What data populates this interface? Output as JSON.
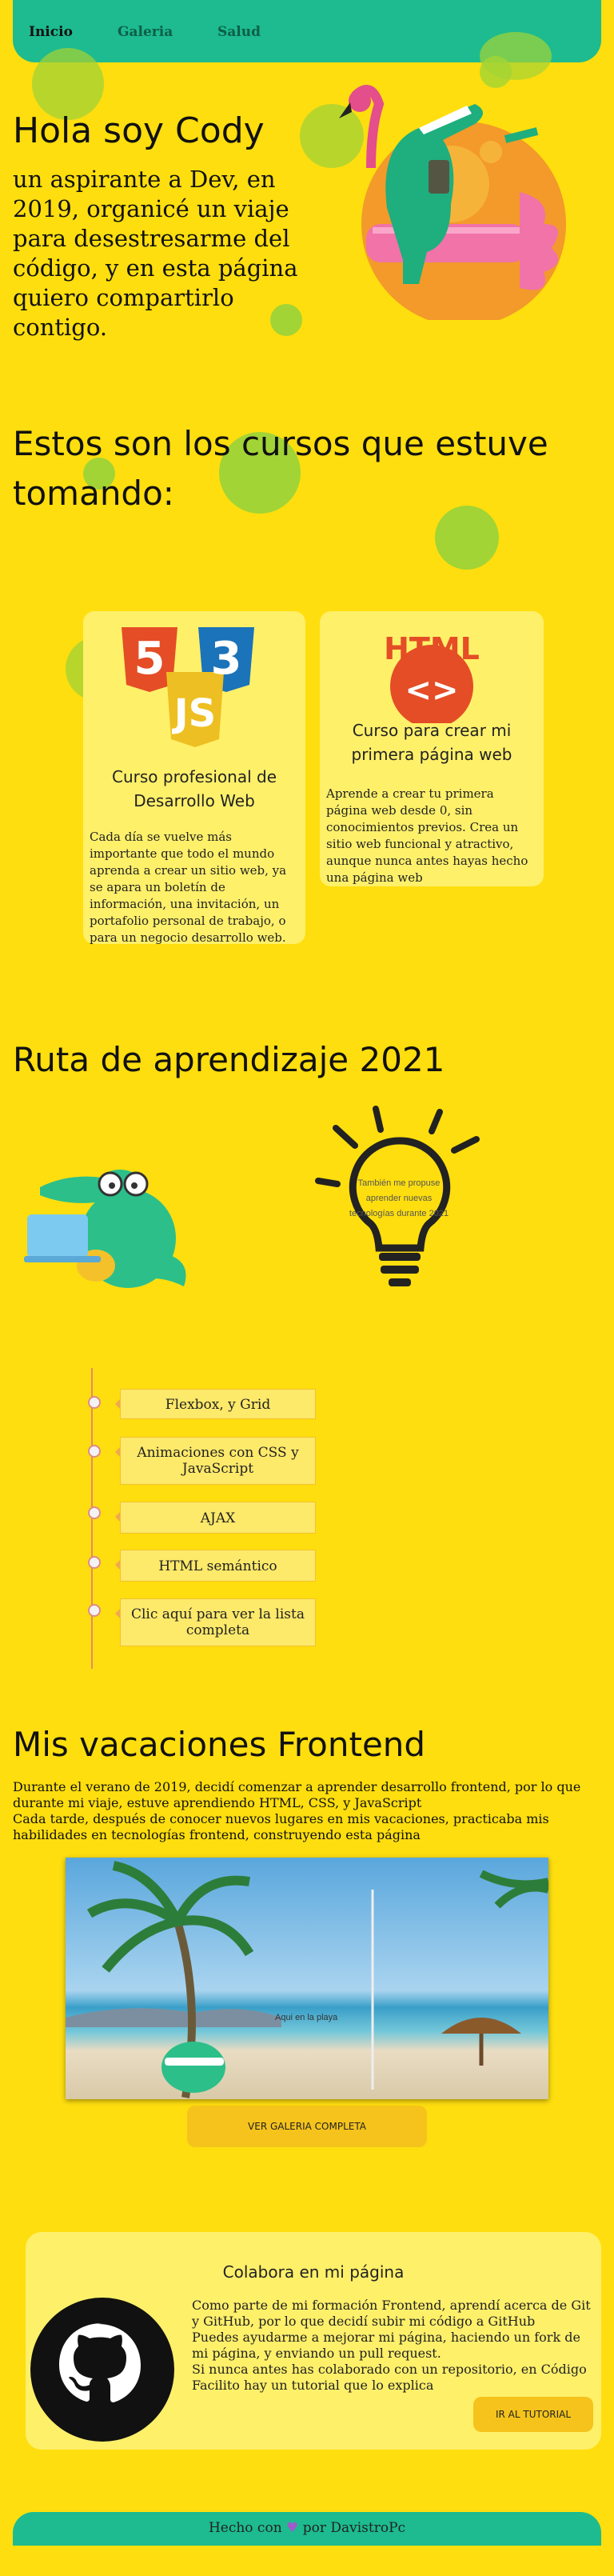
{
  "nav": {
    "items": [
      "Inicio",
      "Galeria",
      "Salud"
    ]
  },
  "hero": {
    "title": "Hola soy Cody",
    "intro": "un aspirante a Dev, en 2019, organicé un viaje para desestresarme del código, y en esta página quiero compartirlo contigo."
  },
  "courses": {
    "heading": "Estos son los cursos que estuve tomando:",
    "items": [
      {
        "title": "Curso profesional de Desarrollo Web",
        "text": "Cada día se vuelve más importante que todo el mundo aprenda a crear un sitio web, ya se apara un boletín de información, una invitación, un portafolio personal de trabajo, o para un negocio desarrollo web."
      },
      {
        "title": "Curso para crear mi primera página web",
        "text": "Aprende a crear tu primera página web desde 0, sin conocimientos previos. Crea un sitio web funcional y atractivo, aunque nunca antes hayas hecho una página web"
      }
    ],
    "badges": {
      "html": "HTML",
      "html_glyph": "<>",
      "css": "3",
      "html5": "5",
      "js": "JS"
    }
  },
  "ruta": {
    "heading": "Ruta de aprendizaje 2021",
    "bulb_text": "También me propuse aprender nuevas tecnologías durante 2021",
    "timeline": [
      "Flexbox, y Grid",
      "Animaciones con CSS y JavaScript",
      "AJAX",
      "HTML semántico",
      "Clic aquí para ver la lista completa"
    ]
  },
  "vacaciones": {
    "heading": "Mis vacaciones Frontend",
    "paragraph1": "Durante el verano de 2019, decidí comenzar a aprender desarrollo frontend, por lo que durante mi viaje, estuve aprendiendo HTML, CSS, y JavaScript",
    "paragraph2": "Cada tarde, después de conocer nuevos lugares en mis vacaciones, practicaba mis habilidades en tecnologías frontend, construyendo esta página",
    "image_caption": "Aqui en la playa",
    "gallery_button": "VER GALERIA COMPLETA"
  },
  "colabora": {
    "heading": "Colabora en mi página",
    "text1": "Como parte de mi formación Frontend, aprendí acerca de Git y GitHub, por lo que decidí subir mi código a GitHub",
    "text2": "Puedes ayudarme a mejorar mi página, haciendo un fork de mi página, y enviando un pull request.",
    "text3": "Si nunca antes has colaborado con un repositorio, en Código Facilito hay un tutorial que lo explica",
    "button": "IR AL TUTORIAL"
  },
  "footer": {
    "prefix": "Hecho con",
    "suffix": "por DavistroPc"
  }
}
